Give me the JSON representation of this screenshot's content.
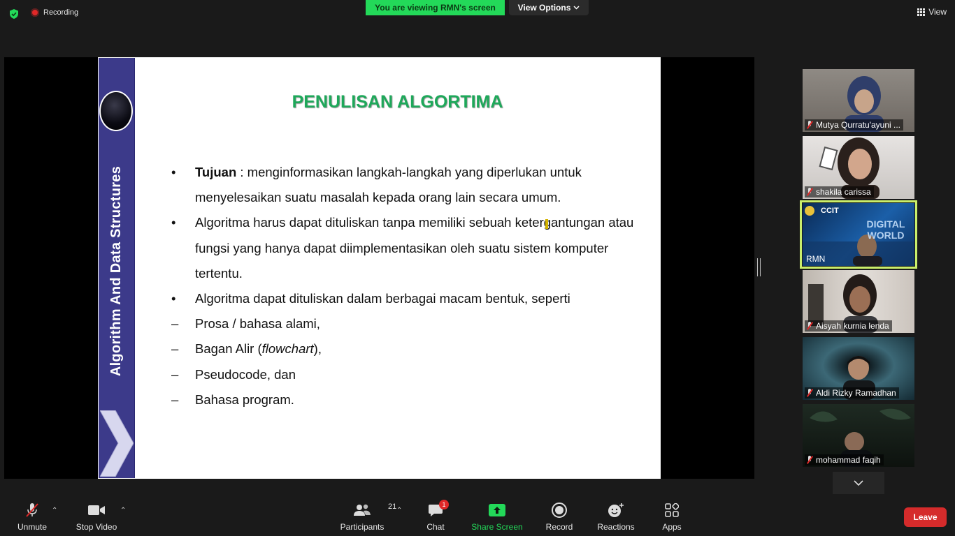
{
  "topbar": {
    "recording_label": "Recording",
    "viewing_banner": "You are viewing RMN's screen",
    "view_options_label": "View Options",
    "view_label": "View"
  },
  "slide": {
    "side_title": "Algorithm And Data Structures",
    "title": "PENULISAN ALGORTIMA",
    "items": [
      {
        "marker": "•",
        "bold": "Tujuan",
        "text": " : menginformasikan langkah-langkah yang diperlukan untuk menyelesaikan suatu masalah kepada orang lain secara umum."
      },
      {
        "marker": "•",
        "text": "Algoritma harus dapat dituliskan tanpa memiliki sebuah ketergantungan atau fungsi yang hanya dapat diimplementasikan oleh suatu sistem komputer tertentu."
      },
      {
        "marker": "•",
        "text": "Algoritma dapat dituliskan dalam berbagai macam bentuk, seperti"
      },
      {
        "marker": "–",
        "text": "Prosa / bahasa alami,"
      },
      {
        "marker": "–",
        "pre": "Bagan Alir (",
        "italic": "flowchart",
        "post": "),"
      },
      {
        "marker": "–",
        "text": "Pseudocode, dan"
      },
      {
        "marker": "–",
        "text": "Bahasa program."
      }
    ]
  },
  "participants": [
    {
      "name": "Mutya Qurratu'ayuni ...",
      "muted": true,
      "bg": "#7a7570"
    },
    {
      "name": "shakila carissa",
      "muted": true,
      "bg": "#d9d6d4"
    },
    {
      "name": "RMN",
      "muted": false,
      "active": true,
      "bg": "#0d3a6e",
      "overlay_text_1": "CCIT",
      "overlay_text_2": "DIGITAL WORLD"
    },
    {
      "name": "Aisyah kurnia lenda",
      "muted": true,
      "bg": "#cfc9c3"
    },
    {
      "name": "Aldi Rizky Ramadhan",
      "muted": true,
      "bg": "#1f3a44"
    },
    {
      "name": "mohammad faqih",
      "muted": true,
      "bg": "#17211a"
    }
  ],
  "toolbar": {
    "unmute": "Unmute",
    "stop_video": "Stop Video",
    "participants": "Participants",
    "participants_count": "21",
    "chat": "Chat",
    "chat_badge": "1",
    "share_screen": "Share Screen",
    "record": "Record",
    "reactions": "Reactions",
    "apps": "Apps",
    "leave": "Leave"
  },
  "colors": {
    "share_green": "#23d959",
    "leave_red": "#d52b2b",
    "slide_title_green": "#1ea85a",
    "slide_band": "#3c3a8a",
    "active_border": "#c9ee6b"
  }
}
